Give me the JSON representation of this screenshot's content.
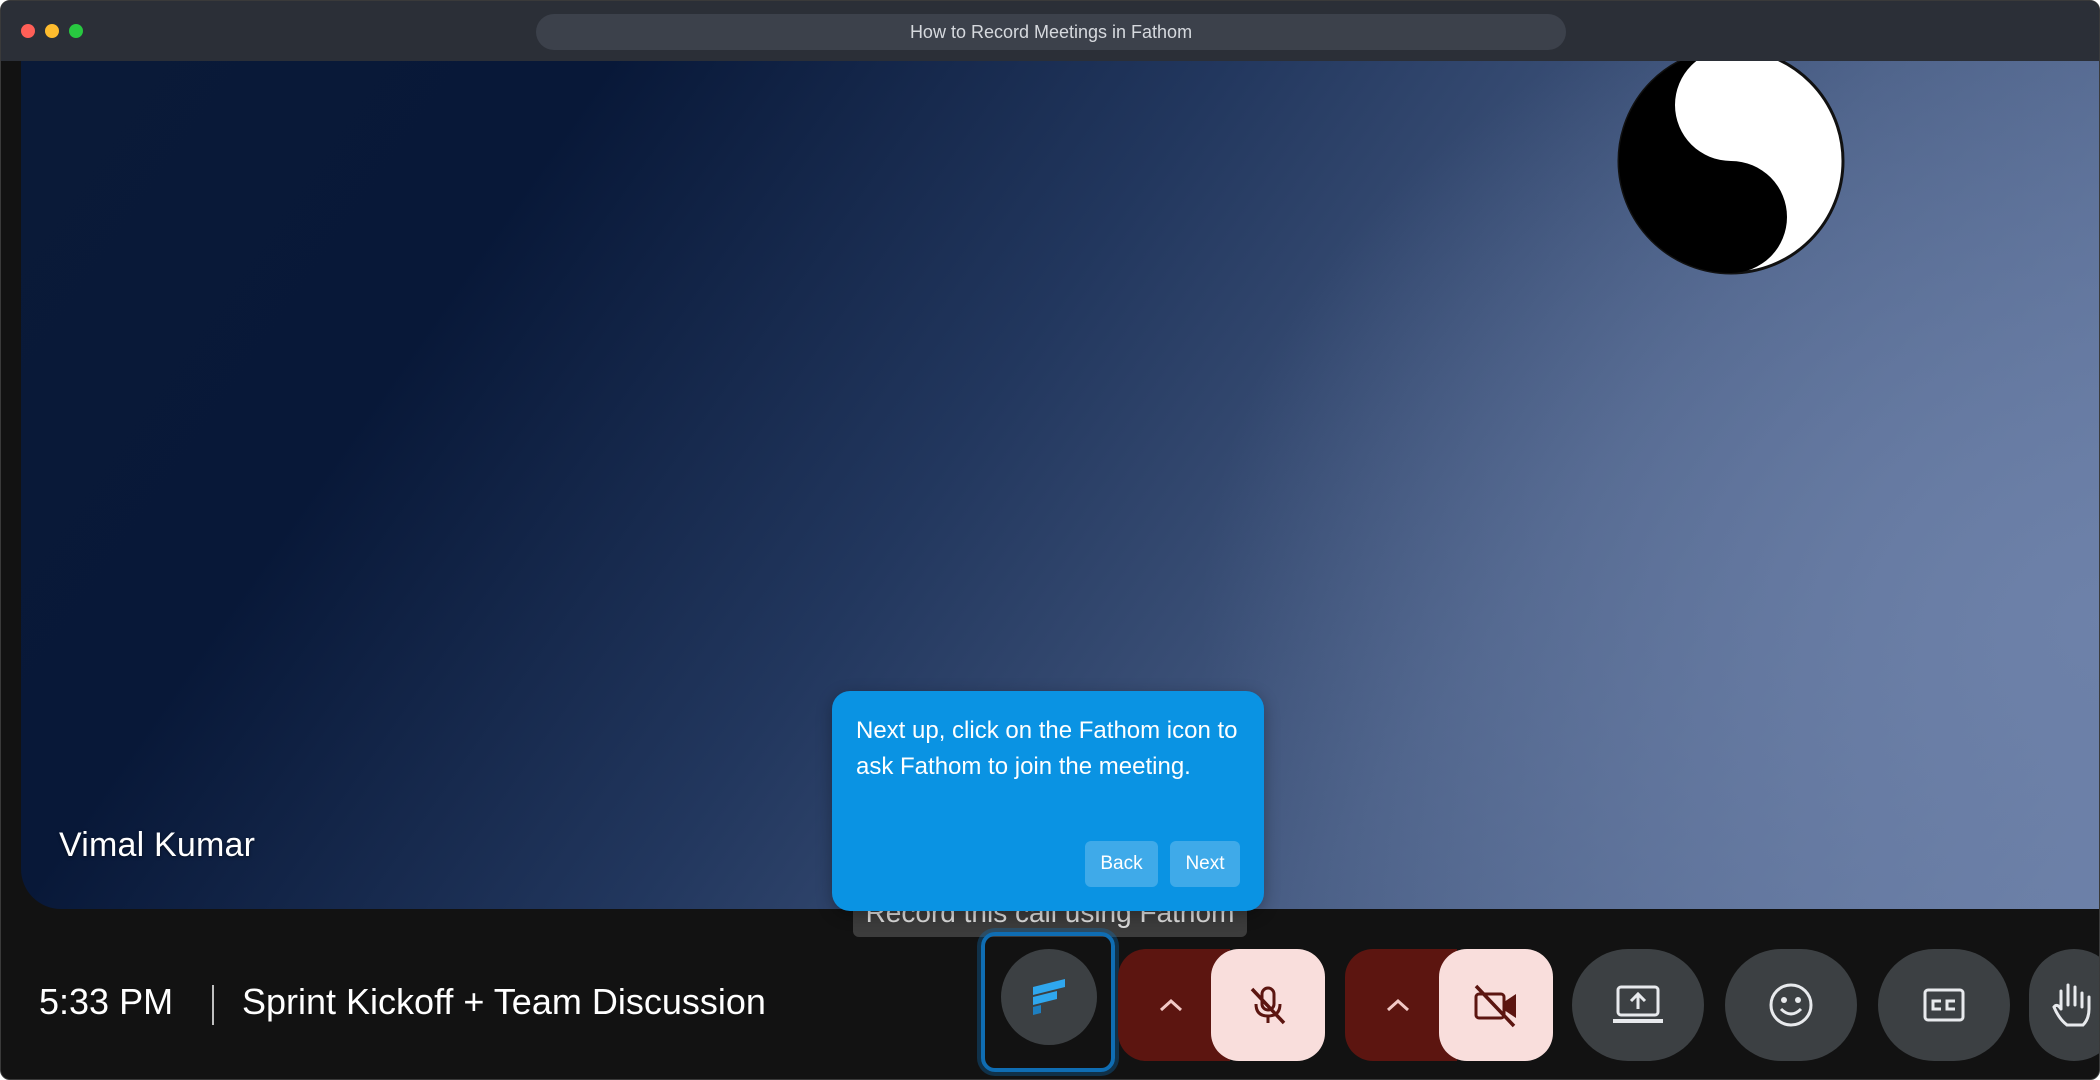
{
  "window": {
    "title": "How to Record Meetings in Fathom"
  },
  "stage": {
    "participant_name": "Vimal Kumar"
  },
  "tour_popover": {
    "message": "Next up, click on the Fathom icon to ask Fathom to join the meeting.",
    "back_label": "Back",
    "next_label": "Next"
  },
  "tooltip": {
    "text": "Record this call using Fathom"
  },
  "bottom_bar": {
    "time": "5:33 PM",
    "meeting_title": "Sprint Kickoff + Team Discussion",
    "controls": [
      {
        "icon": "fathom-icon"
      },
      {
        "icon": "chevron-up-icon"
      },
      {
        "icon": "mic-off-icon"
      },
      {
        "icon": "chevron-up-icon"
      },
      {
        "icon": "camera-off-icon"
      },
      {
        "icon": "present-screen-icon"
      },
      {
        "icon": "emoji-icon"
      },
      {
        "icon": "captions-icon"
      },
      {
        "icon": "raise-hand-icon"
      }
    ]
  },
  "colors": {
    "popover": "#0a93e3",
    "muted_bg": "#f9dedc",
    "muted_dark": "#5c1510",
    "highlight": "#0f6db3"
  }
}
